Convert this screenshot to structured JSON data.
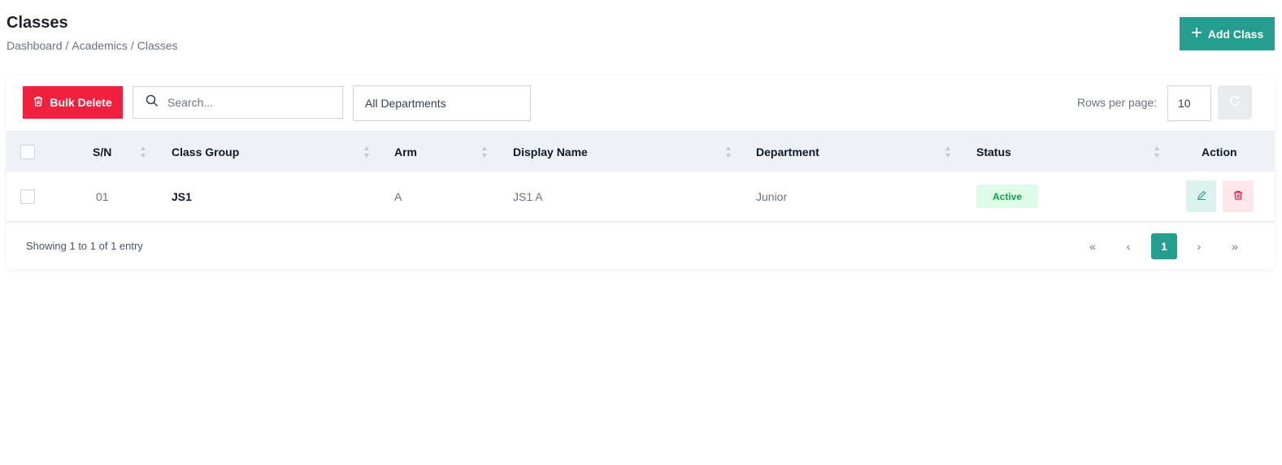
{
  "page": {
    "title": "Classes",
    "breadcrumb": [
      "Dashboard",
      "Academics",
      "Classes"
    ],
    "breadcrumb_separator": "/"
  },
  "actions": {
    "add_label": "Add Class",
    "bulk_delete_label": "Bulk Delete"
  },
  "filters": {
    "search_placeholder": "Search...",
    "department_selected": "All Departments",
    "rows_per_page_label": "Rows per page:",
    "rows_per_page_value": "10"
  },
  "table": {
    "columns": [
      "S/N",
      "Class Group",
      "Arm",
      "Display Name",
      "Department",
      "Status",
      "Action"
    ],
    "rows": [
      {
        "sn": "01",
        "class_group": "JS1",
        "arm": "A",
        "display_name": "JS1 A",
        "department": "Junior",
        "status": "Active"
      }
    ]
  },
  "footer": {
    "info": "Showing 1 to 1 of 1 entry",
    "first": "«",
    "prev": "‹",
    "current_page": "1",
    "next": "›",
    "last": "»"
  },
  "colors": {
    "primary": "#269e8f",
    "danger": "#f0203f",
    "active_badge_bg": "#dcfce7",
    "active_badge_text": "#16a34a"
  }
}
